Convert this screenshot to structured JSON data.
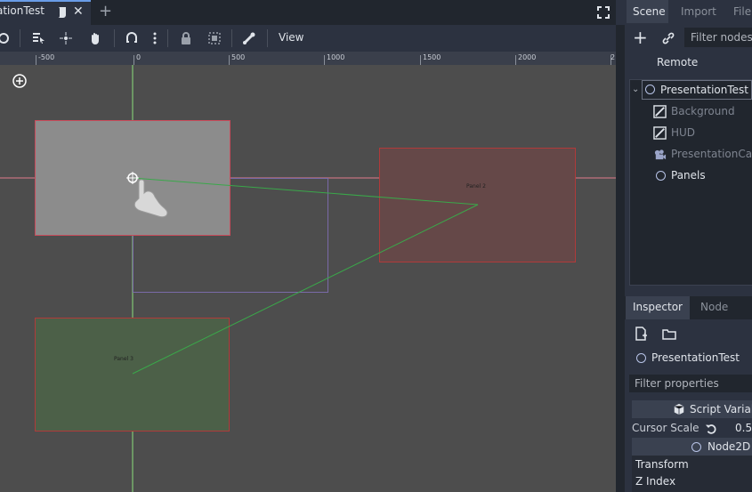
{
  "editor": {
    "tab_label": "ationTest",
    "view_menu": "View"
  },
  "ruler": {
    "labels": [
      "-500",
      "0",
      "500",
      "1000",
      "1500",
      "2000",
      "2"
    ]
  },
  "canvas": {
    "panel_labels": [
      "Panel 3",
      "Panel 2"
    ]
  },
  "dock": {
    "tabs": [
      "Scene",
      "Import",
      "File"
    ],
    "filter_placeholder": "Filter nodes",
    "remote_label": "Remote",
    "tree": [
      {
        "label": "PresentationTest"
      },
      {
        "label": "Background"
      },
      {
        "label": "HUD"
      },
      {
        "label": "PresentationCa"
      },
      {
        "label": "Panels"
      }
    ]
  },
  "inspector": {
    "tabs": [
      "Inspector",
      "Node"
    ],
    "object_name": "PresentationTest",
    "filter_placeholder": "Filter properties",
    "script_section": "Script Variab",
    "cursor_scale_label": "Cursor Scale",
    "cursor_scale_value": "0.5",
    "node2d_section": "Node2D",
    "transform_label": "Transform",
    "zindex_label": "Z Index"
  },
  "colors": {
    "accent": "#699ce8",
    "canvas": "#4d4d4d"
  }
}
